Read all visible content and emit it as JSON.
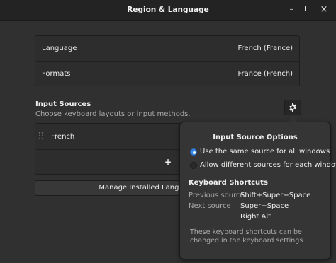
{
  "window": {
    "title": "Region & Language",
    "min_icon": "minimize-icon",
    "max_icon": "maximize-icon",
    "close_icon": "close-icon"
  },
  "settings": {
    "language_label": "Language",
    "language_value": "French (France)",
    "formats_label": "Formats",
    "formats_value": "France (French)"
  },
  "input_sources": {
    "title": "Input Sources",
    "subtitle": "Choose keyboard layouts or input methods.",
    "items": [
      {
        "name": "French"
      }
    ],
    "add_label": "+",
    "options_icon": "gear-icon"
  },
  "manage_button": {
    "label": "Manage Installed Languages"
  },
  "popover": {
    "title": "Input Source Options",
    "options": [
      {
        "label": "Use the same source for all windows",
        "selected": true
      },
      {
        "label": "Allow different sources for each window",
        "selected": false
      }
    ],
    "shortcuts_title": "Keyboard Shortcuts",
    "shortcuts": [
      {
        "label": "Previous source",
        "value": "Shift+Super+Space"
      },
      {
        "label": "Next source",
        "value": "Super+Space"
      },
      {
        "label": "",
        "value": "Right Alt"
      }
    ],
    "note": "These keyboard shortcuts can be changed in the keyboard settings"
  },
  "colors": {
    "background": "#303030",
    "titlebar": "#232323",
    "accent": "#3584e4"
  }
}
